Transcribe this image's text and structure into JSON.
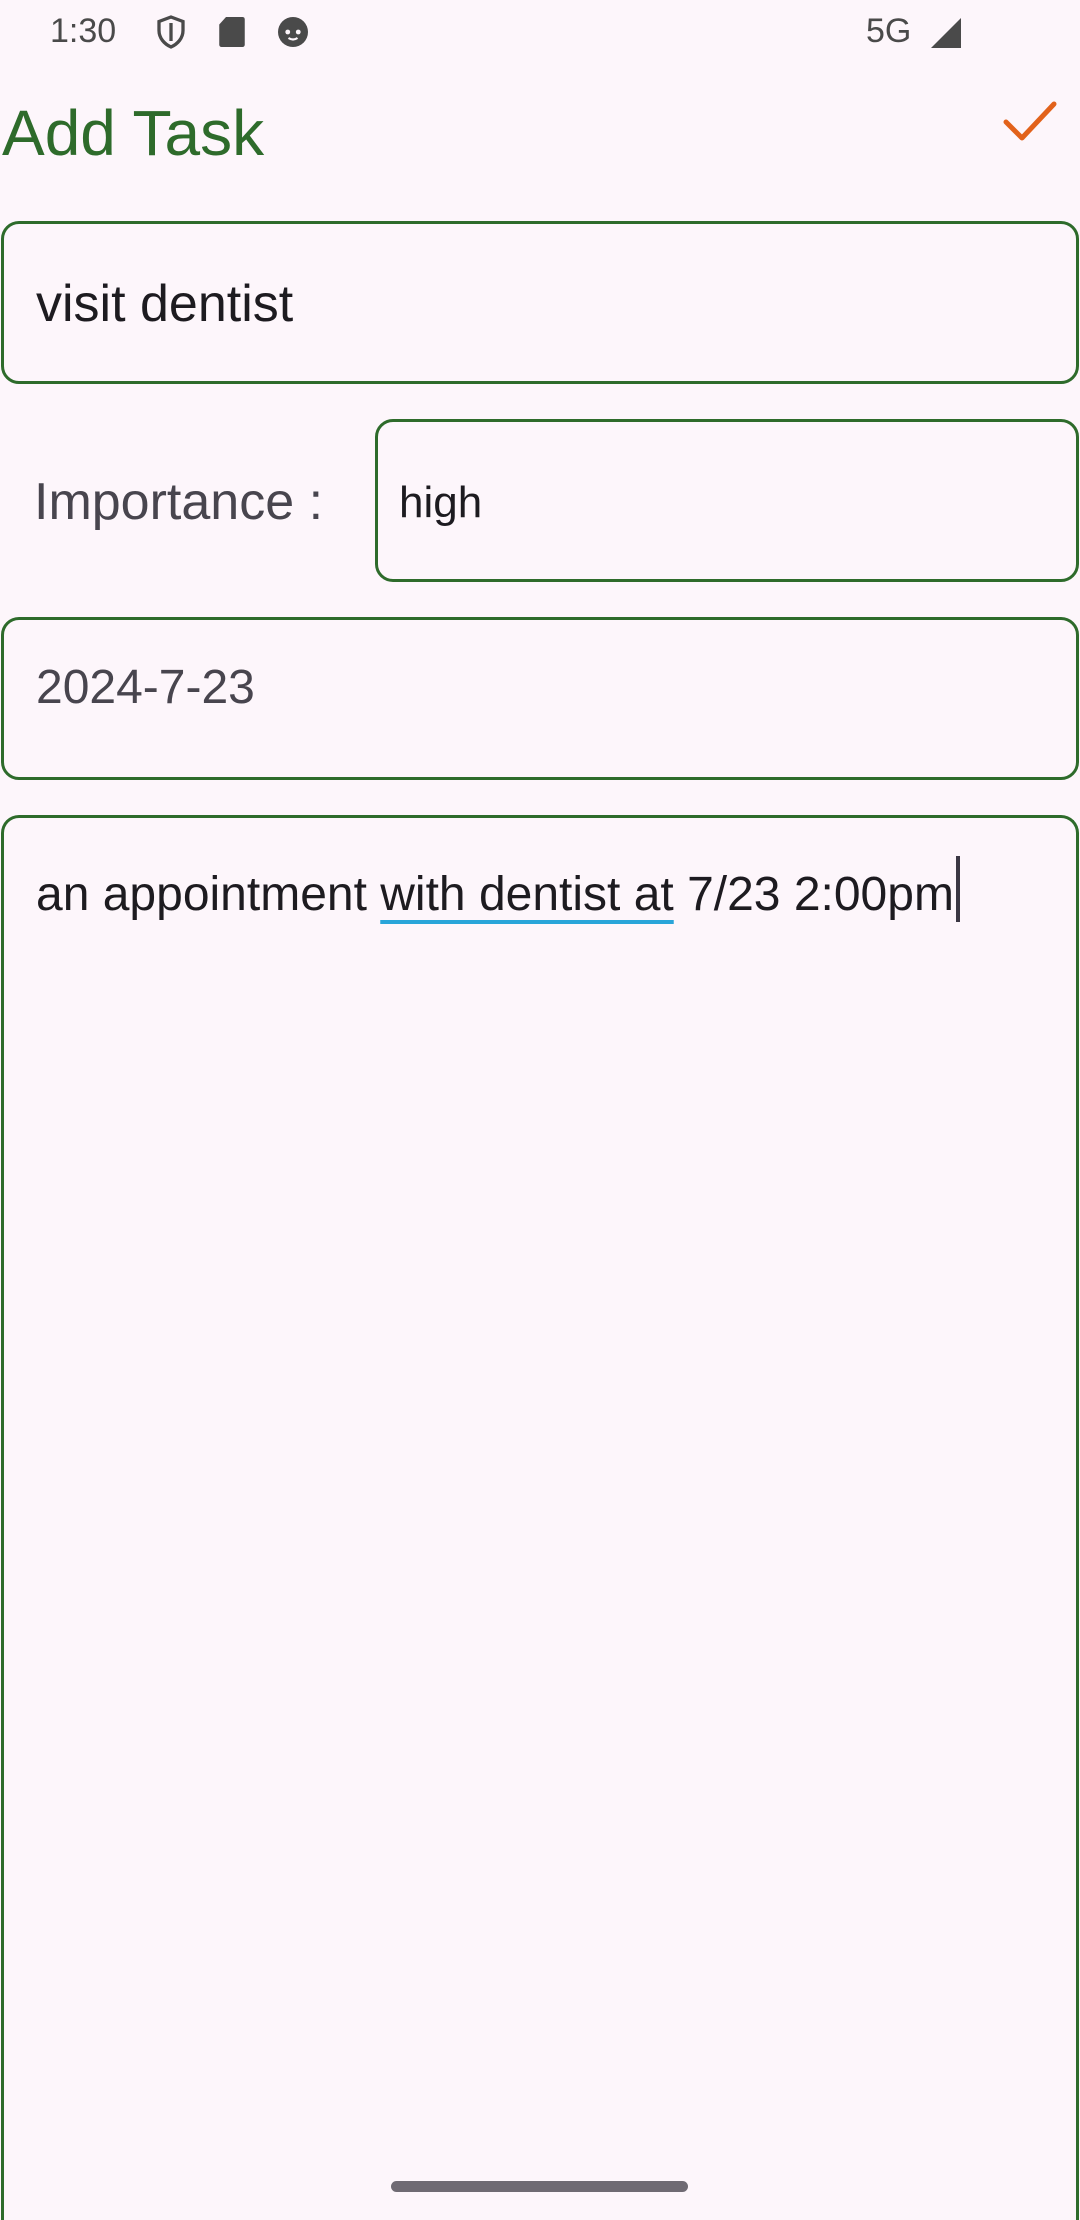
{
  "status_bar": {
    "time": "1:30",
    "network": "5G",
    "icons": [
      "shield-icon",
      "sd-card-icon",
      "cat-face-icon",
      "signal-icon"
    ]
  },
  "app_bar": {
    "title": "Add Task",
    "save_icon": "check-icon",
    "accent_color": "#e2621b"
  },
  "form": {
    "title_value": "visit dentist",
    "importance_label": "Importance :",
    "importance_value": "high",
    "date_value": "2024-7-23",
    "description": {
      "part1": "an appointment ",
      "part2": "with dentist at",
      "part3": " 7/23 2:00pm"
    }
  },
  "colors": {
    "primary": "#2e6b2b",
    "background": "#fdf6fb",
    "underline": "#29a5d9"
  }
}
